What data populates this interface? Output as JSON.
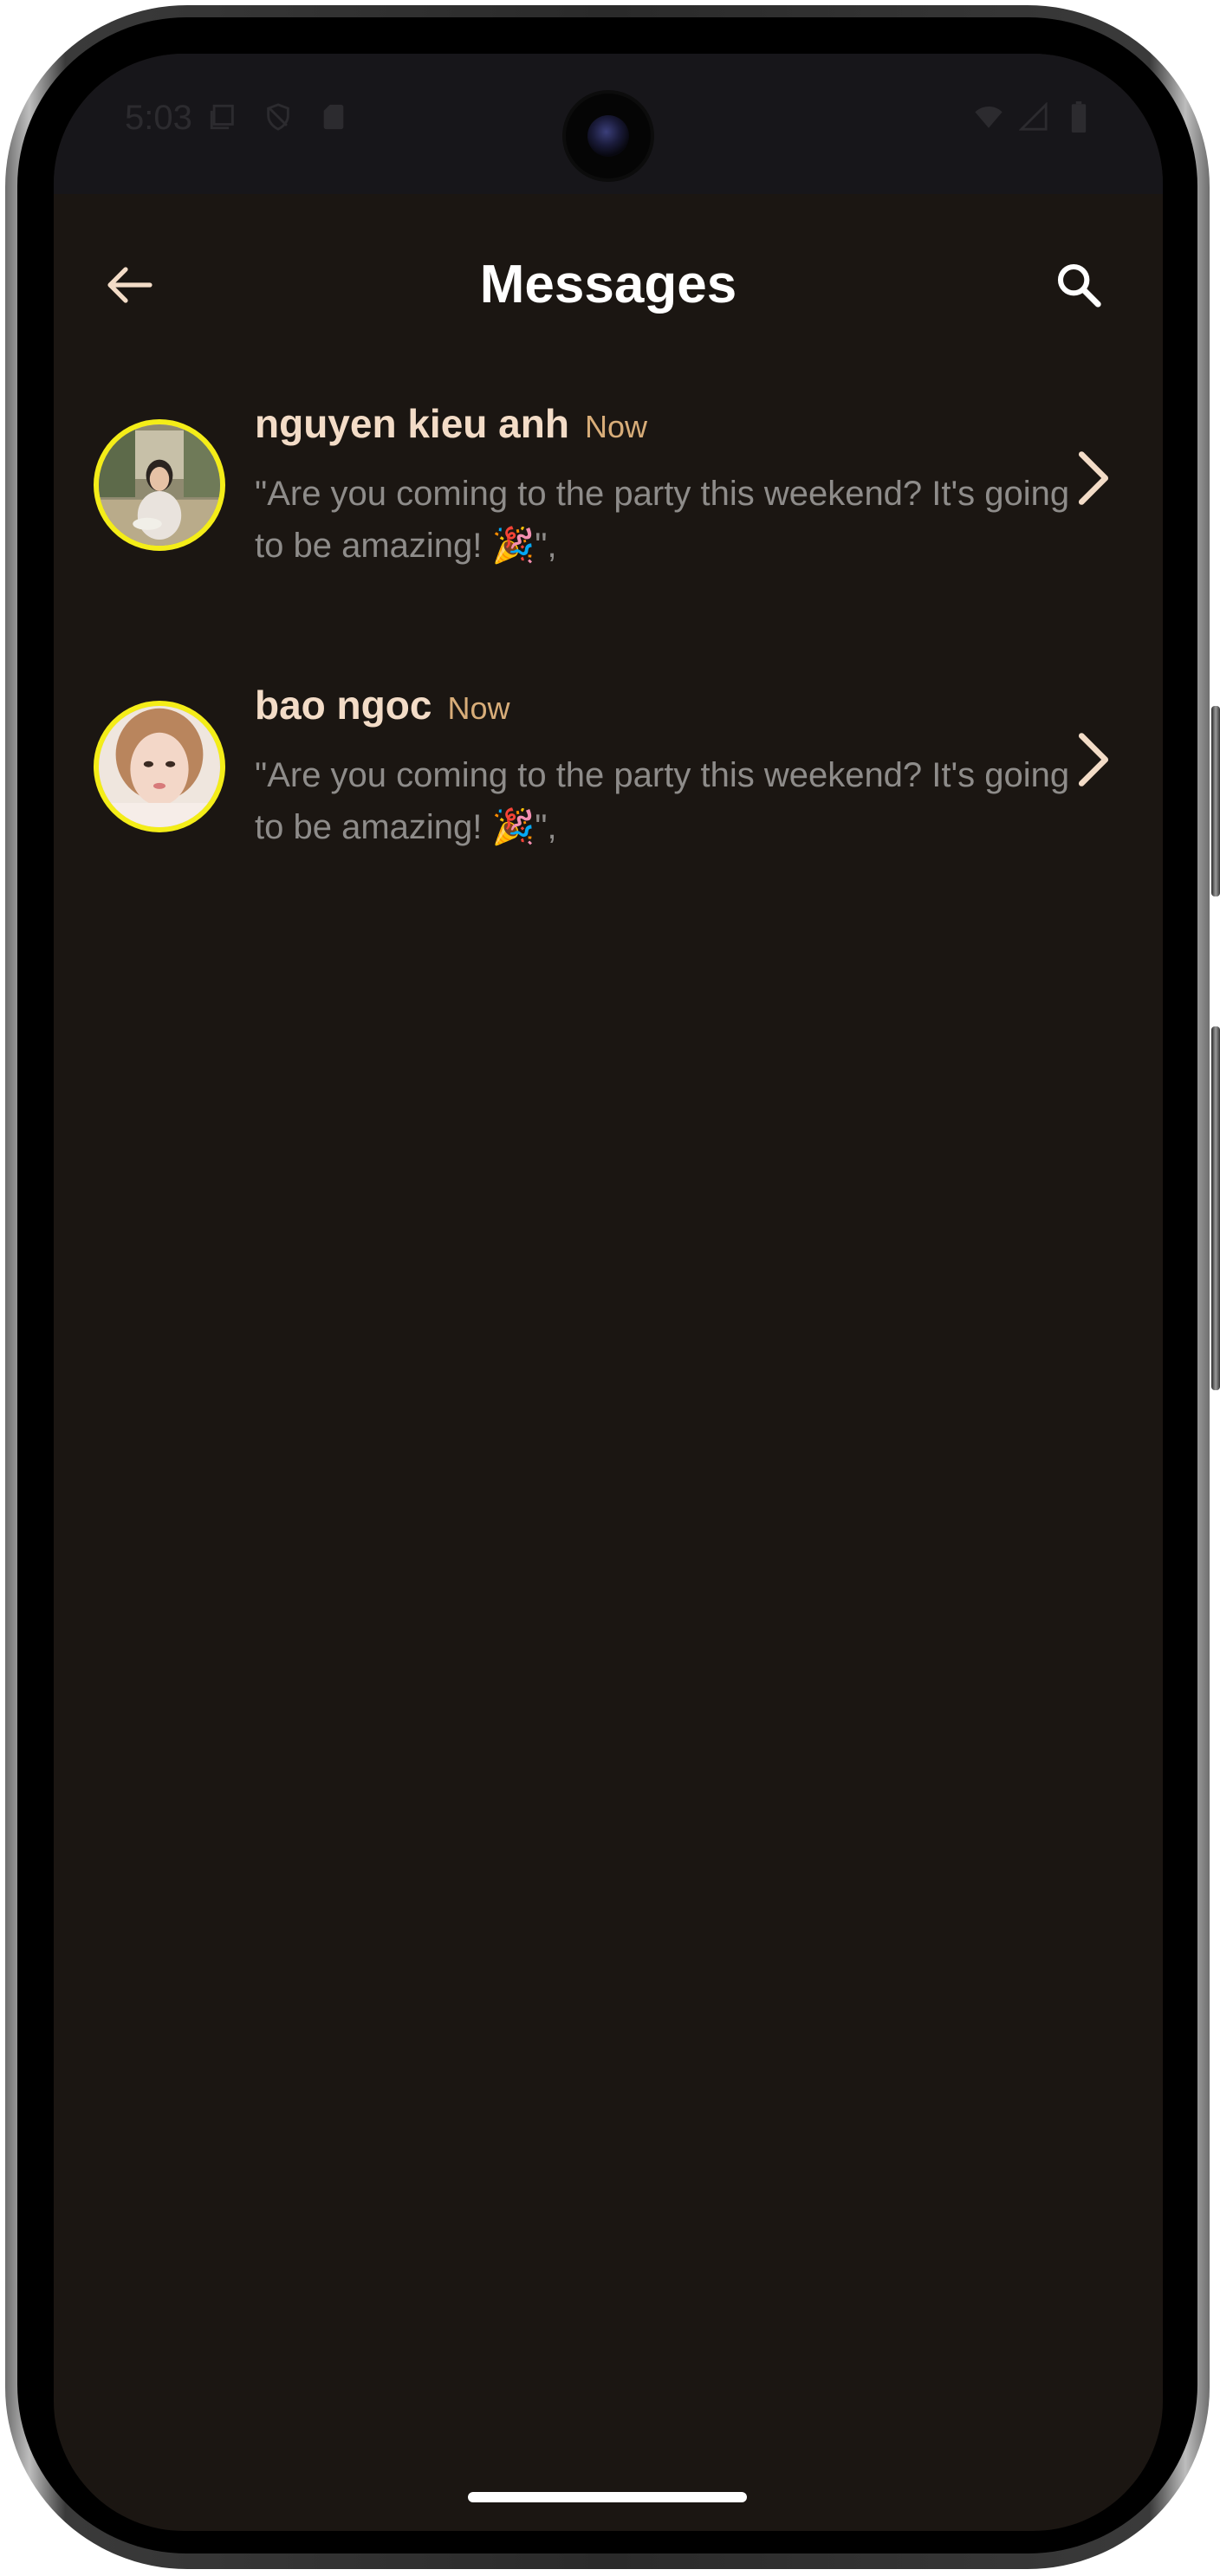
{
  "status_bar": {
    "time": "5:03",
    "left_icons": [
      "notification-stack-icon",
      "shield-icon",
      "sd-card-icon"
    ],
    "right_icons": [
      "wifi-icon",
      "cellular-signal-icon",
      "battery-icon"
    ]
  },
  "app_bar": {
    "title": "Messages",
    "back_icon": "arrow-left-icon",
    "search_icon": "search-icon"
  },
  "messages": [
    {
      "sender": "nguyen kieu anh",
      "time": "Now",
      "preview": "\"Are you coming to the party this weekend? It's going to be amazing! 🎉\","
    },
    {
      "sender": "bao ngoc",
      "time": "Now",
      "preview": "\"Are you coming to the party this weekend? It's going to be amazing! 🎉\","
    }
  ],
  "colors": {
    "background": "#1b1612",
    "status_bar": "#17161a",
    "title": "#ffffff",
    "sender": "#f3dcc7",
    "time": "#d8ad79",
    "preview": "#8e8c8a",
    "avatar_ring": "#f4ed18",
    "chevron": "#f3dcc7"
  }
}
